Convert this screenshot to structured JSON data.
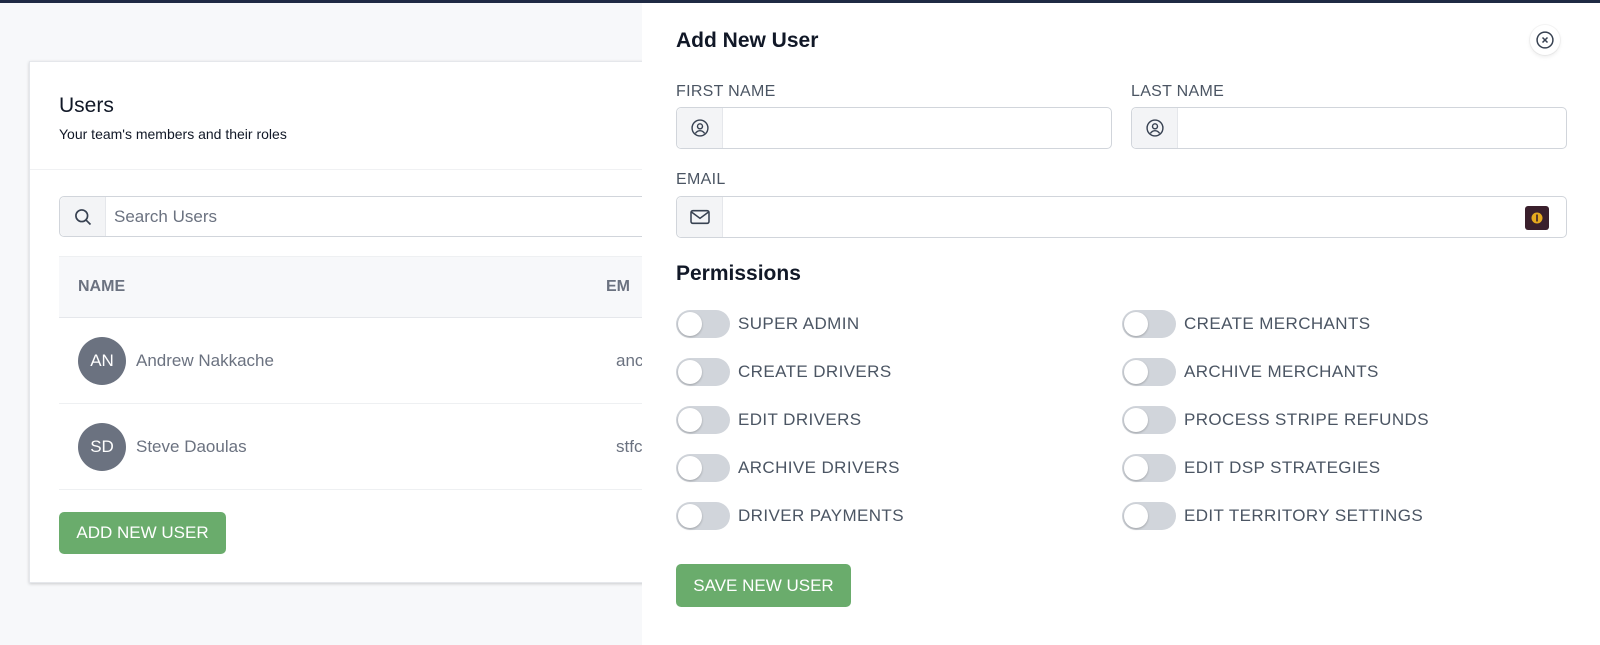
{
  "users_page": {
    "title": "Users",
    "subtitle": "Your team's members and their roles",
    "search_placeholder": "Search Users",
    "columns": [
      "NAME",
      "EM"
    ],
    "rows": [
      {
        "initials": "AN",
        "name": "Andrew Nakkache",
        "email": "anc"
      },
      {
        "initials": "SD",
        "name": "Steve Daoulas",
        "email": "stfc"
      }
    ],
    "add_button": "ADD NEW USER"
  },
  "panel": {
    "title": "Add New User",
    "first_name_label": "FIRST NAME",
    "first_name_value": "",
    "last_name_label": "LAST NAME",
    "last_name_value": "",
    "email_label": "EMAIL",
    "email_value": "",
    "permissions_title": "Permissions",
    "permissions_left": [
      {
        "label": "SUPER ADMIN",
        "enabled": false
      },
      {
        "label": "CREATE DRIVERS",
        "enabled": false
      },
      {
        "label": "EDIT DRIVERS",
        "enabled": false
      },
      {
        "label": "ARCHIVE DRIVERS",
        "enabled": false
      },
      {
        "label": "DRIVER PAYMENTS",
        "enabled": false
      }
    ],
    "permissions_right": [
      {
        "label": "CREATE MERCHANTS",
        "enabled": false
      },
      {
        "label": "ARCHIVE MERCHANTS",
        "enabled": false
      },
      {
        "label": "PROCESS STRIPE REFUNDS",
        "enabled": false
      },
      {
        "label": "EDIT DSP STRATEGIES",
        "enabled": false
      },
      {
        "label": "EDIT TERRITORY SETTINGS",
        "enabled": false
      }
    ],
    "save_button": "SAVE NEW USER"
  },
  "colors": {
    "accent_green": "#6aac6c",
    "avatar_gray": "#6b7280",
    "topbar": "#1f2a44"
  }
}
